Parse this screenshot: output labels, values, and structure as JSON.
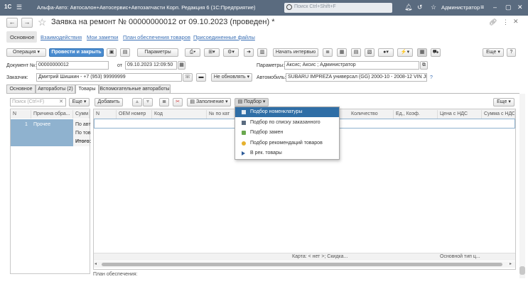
{
  "app": {
    "title": "Альфа-Авто: Автосалон+Автосервис+Автозапчасти Корп. Редакция 6  (1С:Предприятие)",
    "search_placeholder": "Поиск Ctrl+Shift+F",
    "user": "Администратор"
  },
  "window": {
    "title": "Заявка на ремонт № 00000000012 от 09.10.2023 (проведен) *"
  },
  "nav_links": [
    "Основное",
    "Взаимодействия",
    "Мои заметки",
    "План обеспечения товаров",
    "Присоединенные файлы"
  ],
  "toolbar": {
    "operation": "Операция",
    "post_close": "Провести и закрыть",
    "params": "Параметры",
    "start_interview": "Начать интервью",
    "more": "Еще",
    "help": "?"
  },
  "form": {
    "doc_no_label": "Документ №:",
    "doc_no": "00000000012",
    "from_label": "от",
    "date": "09.10.2023 12:09:50",
    "params_label": "Параметры:",
    "params_value": "Аксис; Аксис ; Администратор",
    "customer_label": "Заказчик:",
    "customer": "Дмитрий Шишкин - +7 (953) 99999999",
    "no_update": "Не обновлять",
    "auto_label": "Автомобиль:",
    "auto": "SUBARU IMPREZA универсал (GG) 2000-10 - 2008-12 VIN JF1GG:",
    "auto_q": "?"
  },
  "tabs": [
    "Основное",
    "Автоработы (2)",
    "Товары",
    "Вспомогательные автоработы"
  ],
  "left_panel": {
    "search_placeholder": "Поиск (Ctrl+F)",
    "more": "Еще",
    "col_n": "N",
    "col_reason": "Причина обра...",
    "col_sum": "Сумм",
    "row_n": "1",
    "row_reason": "Прочее",
    "row_sum1": "По авт",
    "row_sum2": "По тов",
    "row_total": "Итого:"
  },
  "goods": {
    "add": "Добавить",
    "fill": "Заполнение",
    "select": "Подбор",
    "more": "Еще",
    "columns": [
      "N",
      "OEM номер",
      "Код",
      "№ по кат",
      "Количество",
      "Ед., Коэф.",
      "Цена с НДС",
      "Сумма с НДС"
    ],
    "footer_card": "Карта: < нет >; Скидка...",
    "footer_main_type": "Основной тип ц...",
    "bottom_label": "План обеспечения:"
  },
  "dropdown": {
    "items": [
      "Подбор номенклатуры",
      "Подбор по списку заказанного",
      "Подбор замен",
      "Подбор рекомендаций товаров",
      "В рек. товары"
    ]
  }
}
